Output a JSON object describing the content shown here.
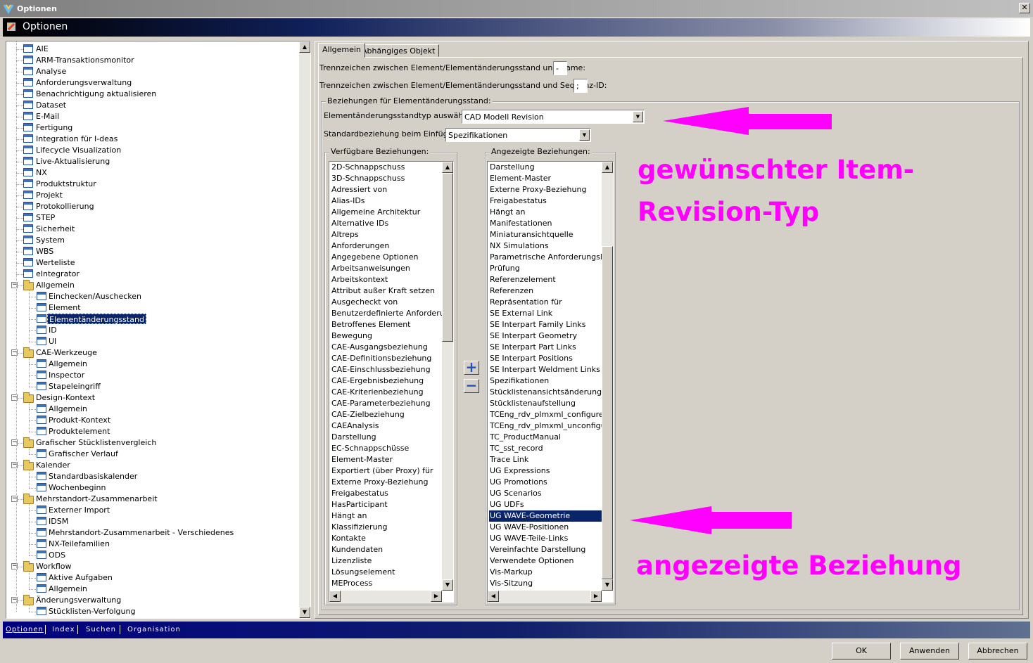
{
  "window": {
    "title": "Optionen",
    "header": "Optionen",
    "close_label": "✕"
  },
  "tree": {
    "items": [
      {
        "label": "AIE",
        "level": 1,
        "kind": "leaf"
      },
      {
        "label": "ARM-Transaktionsmonitor",
        "level": 1,
        "kind": "leaf"
      },
      {
        "label": "Analyse",
        "level": 1,
        "kind": "leaf"
      },
      {
        "label": "Anforderungsverwaltung",
        "level": 1,
        "kind": "leaf"
      },
      {
        "label": "Benachrichtigung aktualisieren",
        "level": 1,
        "kind": "leaf"
      },
      {
        "label": "Dataset",
        "level": 1,
        "kind": "leaf"
      },
      {
        "label": "E-Mail",
        "level": 1,
        "kind": "leaf"
      },
      {
        "label": "Fertigung",
        "level": 1,
        "kind": "leaf"
      },
      {
        "label": "Integration für I-deas",
        "level": 1,
        "kind": "leaf"
      },
      {
        "label": "Lifecycle Visualization",
        "level": 1,
        "kind": "leaf"
      },
      {
        "label": "Live-Aktualisierung",
        "level": 1,
        "kind": "leaf"
      },
      {
        "label": "NX",
        "level": 1,
        "kind": "leaf"
      },
      {
        "label": "Produktstruktur",
        "level": 1,
        "kind": "leaf"
      },
      {
        "label": "Projekt",
        "level": 1,
        "kind": "leaf"
      },
      {
        "label": "Protokollierung",
        "level": 1,
        "kind": "leaf"
      },
      {
        "label": "STEP",
        "level": 1,
        "kind": "leaf"
      },
      {
        "label": "Sicherheit",
        "level": 1,
        "kind": "leaf"
      },
      {
        "label": "System",
        "level": 1,
        "kind": "leaf"
      },
      {
        "label": "WBS",
        "level": 1,
        "kind": "leaf"
      },
      {
        "label": "Werteliste",
        "level": 1,
        "kind": "leaf"
      },
      {
        "label": "eIntegrator",
        "level": 1,
        "kind": "leaf"
      },
      {
        "label": "Allgemein",
        "level": 1,
        "kind": "folder"
      },
      {
        "label": "Einchecken/Auschecken",
        "level": 2,
        "kind": "leaf"
      },
      {
        "label": "Element",
        "level": 2,
        "kind": "leaf"
      },
      {
        "label": "Elementänderungsstand",
        "level": 2,
        "kind": "leaf",
        "selected": true
      },
      {
        "label": "ID",
        "level": 2,
        "kind": "leaf"
      },
      {
        "label": "UI",
        "level": 2,
        "kind": "leaf"
      },
      {
        "label": "CAE-Werkzeuge",
        "level": 1,
        "kind": "folder"
      },
      {
        "label": "Allgemein",
        "level": 2,
        "kind": "leaf"
      },
      {
        "label": "Inspector",
        "level": 2,
        "kind": "leaf"
      },
      {
        "label": "Stapeleingriff",
        "level": 2,
        "kind": "leaf"
      },
      {
        "label": "Design-Kontext",
        "level": 1,
        "kind": "folder"
      },
      {
        "label": "Allgemein",
        "level": 2,
        "kind": "leaf"
      },
      {
        "label": "Produkt-Kontext",
        "level": 2,
        "kind": "leaf"
      },
      {
        "label": "Produktelement",
        "level": 2,
        "kind": "leaf"
      },
      {
        "label": "Grafischer Stücklistenvergleich",
        "level": 1,
        "kind": "folder"
      },
      {
        "label": "Grafischer Verlauf",
        "level": 2,
        "kind": "leaf"
      },
      {
        "label": "Kalender",
        "level": 1,
        "kind": "folder"
      },
      {
        "label": "Standardbasiskalender",
        "level": 2,
        "kind": "leaf"
      },
      {
        "label": "Wochenbeginn",
        "level": 2,
        "kind": "leaf"
      },
      {
        "label": "Mehrstandort-Zusammenarbeit",
        "level": 1,
        "kind": "folder"
      },
      {
        "label": "Externer Import",
        "level": 2,
        "kind": "leaf"
      },
      {
        "label": "IDSM",
        "level": 2,
        "kind": "leaf"
      },
      {
        "label": "Mehrstandort-Zusammenarbeit - Verschiedenes",
        "level": 2,
        "kind": "leaf"
      },
      {
        "label": "NX-Teilefamilien",
        "level": 2,
        "kind": "leaf"
      },
      {
        "label": "ODS",
        "level": 2,
        "kind": "leaf"
      },
      {
        "label": "Workflow",
        "level": 1,
        "kind": "folder"
      },
      {
        "label": "Aktive Aufgaben",
        "level": 2,
        "kind": "leaf"
      },
      {
        "label": "Allgemein",
        "level": 2,
        "kind": "leaf"
      },
      {
        "label": "Änderungsverwaltung",
        "level": 1,
        "kind": "folder"
      },
      {
        "label": "Stücklisten-Verfolgung",
        "level": 2,
        "kind": "leaf"
      }
    ]
  },
  "tabs": [
    {
      "label": "Allgemein",
      "active": true
    },
    {
      "label": "Abhängiges Objekt",
      "active": false
    }
  ],
  "form": {
    "sep_name_label": "Trennzeichen zwischen Element/Elementänderungsstand und Name:",
    "sep_name_value": "-",
    "sep_seq_label": "Trennzeichen zwischen Element/Elementänderungsstand und Sequenz-ID:",
    "sep_seq_value": ";",
    "group_label": "Beziehungen für Elementänderungsstand:",
    "type_label": "Elementänderungsstandtyp auswählen:",
    "type_value": "CAD Modell Revision",
    "default_label": "Standardbeziehung beim Einfügen:",
    "default_value": "Spezifikationen",
    "available_label": "Verfügbare Beziehungen:",
    "shown_label": "Angezeigte Beziehungen:",
    "add_label": "+",
    "remove_label": "−"
  },
  "available": [
    "2D-Schnappschuss",
    "3D-Schnappschuss",
    "Adressiert von",
    "Alias-IDs",
    "Allgemeine Architektur",
    "Alternative IDs",
    "Altreps",
    "Anforderungen",
    "Angegebene Optionen",
    "Arbeitsanweisungen",
    "Arbeitskontext",
    "Attribut außer Kraft setzen",
    "Ausgecheckt von",
    "Benutzerdefinierte Anforderungsl",
    "Betroffenes Element",
    "Bewegung",
    "CAE-Ausgangsbeziehung",
    "CAE-Definitionsbeziehung",
    "CAE-Einschlussbeziehung",
    "CAE-Ergebnisbeziehung",
    "CAE-Kriterienbeziehung",
    "CAE-Parameterbeziehung",
    "CAE-Zielbeziehung",
    "CAEAnalysis",
    "Darstellung",
    "EC-Schnappschüsse",
    "Element-Master",
    "Exportiert (über Proxy) für",
    "Externe Proxy-Beziehung",
    "Freigabestatus",
    "HasParticipant",
    "Hängt an",
    "Klassifizierung",
    "Kontakte",
    "Kundendaten",
    "Lizenzliste",
    "Lösungselement",
    "MEProcess"
  ],
  "shown": [
    "Darstellung",
    "Element-Master",
    "Externe Proxy-Beziehung",
    "Freigabestatus",
    "Hängt an",
    "Manifestationen",
    "Miniaturansichtquelle",
    "NX Simulations",
    "Parametrische Anforderungslister",
    "Prüfung",
    "Referenzelement",
    "Referenzen",
    "Repräsentation für",
    "SE External Link",
    "SE Interpart Family Links",
    "SE Interpart Geometry",
    "SE Interpart Part Links",
    "SE Interpart Positions",
    "SE Interpart Weldment Links",
    "Spezifikationen",
    "Stücklistenansichtsänderungsstär",
    "Stücklistenaufstellung",
    "TCEng_rdv_plmxml_configured",
    "TCEng_rdv_plmxml_unconfigured",
    "TC_ProductManual",
    "TC_sst_record",
    "Trace Link",
    "UG Expressions",
    "UG Promotions",
    "UG Scenarios",
    "UG UDFs",
    "UG WAVE-Geometrie",
    "UG WAVE-Positionen",
    "UG WAVE-Teile-Links",
    "Vereinfachte Darstellung",
    "Verwendete Optionen",
    "Vis-Markup",
    "Vis-Sitzung"
  ],
  "shown_selected": "UG WAVE-Geometrie",
  "annotations": {
    "line1": "gewünschter Item-",
    "line2": "Revision-Typ",
    "line3": "angezeigte Beziehung",
    "color": "#ff00ff"
  },
  "bottom_tabs": [
    {
      "label": "Optionen",
      "active": true
    },
    {
      "label": "Index"
    },
    {
      "label": "Suchen"
    },
    {
      "label": "Organisation"
    }
  ],
  "buttons": {
    "ok": "OK",
    "apply": "Anwenden",
    "cancel": "Abbrechen"
  },
  "colors": {
    "selection": "#0a246a",
    "face": "#d4d0c8"
  }
}
